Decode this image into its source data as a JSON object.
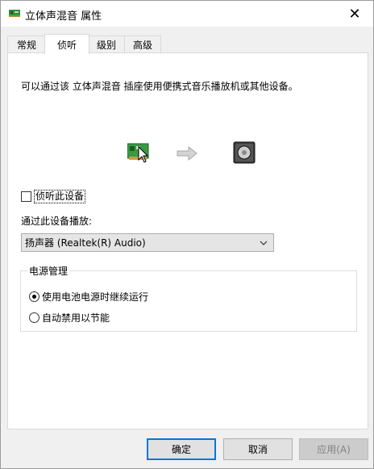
{
  "window": {
    "title": "立体声混音 属性",
    "close_glyph": "✕"
  },
  "tabs": [
    {
      "label": "常规",
      "active": false
    },
    {
      "label": "侦听",
      "active": true
    },
    {
      "label": "级别",
      "active": false
    },
    {
      "label": "高级",
      "active": false
    }
  ],
  "listen": {
    "description": "可以通过该 立体声混音 插座使用便携式音乐播放机或其他设备。",
    "diagram_icons": [
      "sound-card-icon",
      "arrow-right-icon",
      "speaker-icon"
    ],
    "listen_checkbox_label": "侦听此设备",
    "listen_checked": false,
    "playback_label": "通过此设备播放:",
    "playback_device": "扬声器 (Realtek(R) Audio)"
  },
  "power": {
    "group_title": "电源管理",
    "options": [
      {
        "label": "使用电池电源时继续运行",
        "selected": true
      },
      {
        "label": "自动禁用以节能",
        "selected": false
      }
    ]
  },
  "buttons": {
    "ok": "确定",
    "cancel": "取消",
    "apply": "应用(A)"
  },
  "colors": {
    "accent": "#0078d7",
    "window_bg": "#f0f0f0",
    "panel_bg": "#ffffff"
  }
}
